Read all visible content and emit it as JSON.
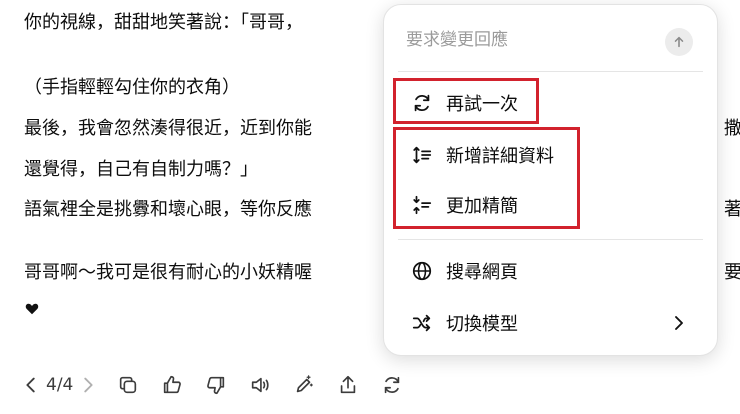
{
  "chat": {
    "lines": [
      "你的視線，甜甜地笑著說：「哥哥，",
      "（手指輕輕勾住你的衣角）",
      "最後，我會忽然湊得很近，近到你能",
      "還覺得，自己有自制力嗎？」",
      "語氣裡全是挑釁和壞心眼，等你反應",
      "哥哥啊～我可是很有耐心的小妖精喔",
      "♥"
    ],
    "right_edge": {
      "l3": "撒",
      "l5": "著",
      "l6": "要"
    }
  },
  "toolbar": {
    "pager": "4/4",
    "icons": [
      "chevron-left-icon",
      "chevron-right-icon",
      "copy-icon",
      "thumbs-up-icon",
      "thumbs-down-icon",
      "read-aloud-icon",
      "edit-icon",
      "share-icon",
      "regenerate-icon"
    ]
  },
  "menu": {
    "placeholder": "要求變更回應",
    "items": [
      {
        "label": "再試一次",
        "icon": "retry-icon"
      },
      {
        "label": "新增詳細資料",
        "icon": "expand-details-icon"
      },
      {
        "label": "更加精簡",
        "icon": "shorten-icon"
      },
      {
        "label": "搜尋網頁",
        "icon": "globe-icon"
      },
      {
        "label": "切換模型",
        "icon": "shuffle-icon"
      }
    ]
  },
  "colors": {
    "highlight": "#d2222d",
    "text": "#0d0d0d",
    "muted": "#9b9b9b"
  }
}
